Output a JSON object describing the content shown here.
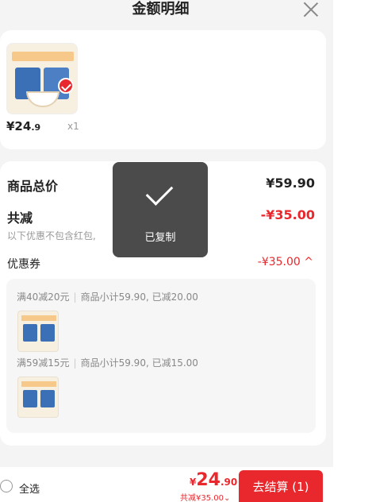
{
  "header": {
    "title": "金额明细"
  },
  "product": {
    "price_int": "¥24",
    "price_dec": ".9",
    "quantity": "x1",
    "image_icon": "product-image"
  },
  "summary": {
    "total_label": "商品总价",
    "total_value": "¥59.90",
    "discount_label": "共减",
    "discount_value": "-¥35.00",
    "note": "以下优惠不包含红包,",
    "coupon_label": "优惠券",
    "coupon_value": "-¥35.00 ^"
  },
  "coupons": [
    {
      "rule": "满40减20元",
      "detail": "商品小计59.90, 已减20.00"
    },
    {
      "rule": "满59减15元",
      "detail": "商品小计59.90, 已减15.00"
    }
  ],
  "toast": {
    "text": "已复制"
  },
  "bottom": {
    "select_all": "全选",
    "price_symbol": "¥",
    "price_int": "24",
    "price_dec": ".90",
    "discount": "共减¥35.00⌄",
    "checkout": "去结算 (1)"
  },
  "colors": {
    "accent": "#e8282d",
    "toast_bg": "#3c3c3c"
  }
}
